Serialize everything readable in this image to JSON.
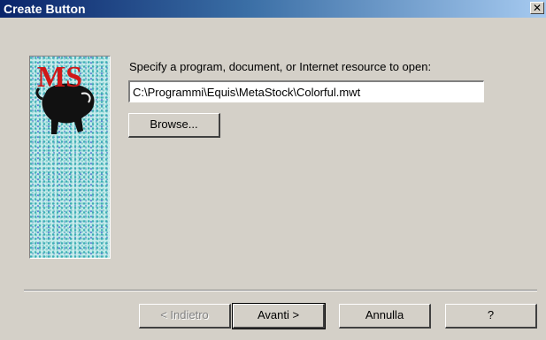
{
  "window": {
    "title": "Create Button",
    "close_glyph": "✕"
  },
  "logo": {
    "text": "MS",
    "icon": "metastock-bull-logo"
  },
  "prompt": "Specify a program, document, or Internet resource to open:",
  "path_input": {
    "value": "C:\\Programmi\\Equis\\MetaStock\\Colorful.mwt"
  },
  "buttons": {
    "browse": "Browse...",
    "back": "< Indietro",
    "next": "Avanti >",
    "cancel": "Annulla",
    "help": "?"
  },
  "colors": {
    "titlebar_start": "#0a246a",
    "titlebar_end": "#a6caf0",
    "dialog_bg": "#d4d0c8",
    "logo_red": "#d01818"
  }
}
